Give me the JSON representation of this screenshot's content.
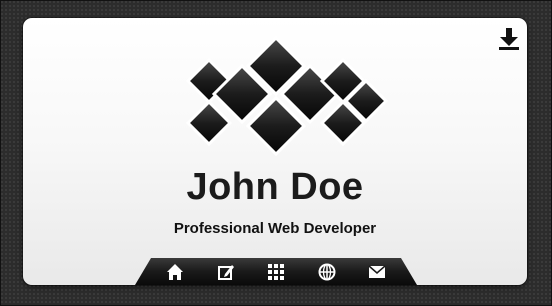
{
  "profile": {
    "name": "John Doe",
    "title": "Professional Web Developer"
  },
  "toolbar": {
    "download_icon": "download-icon"
  },
  "nav": {
    "items": [
      {
        "icon": "home-icon"
      },
      {
        "icon": "edit-icon"
      },
      {
        "icon": "grid-icon"
      },
      {
        "icon": "globe-icon"
      },
      {
        "icon": "mail-icon"
      }
    ]
  },
  "colors": {
    "background": "#2c2c2c",
    "card": "#ffffff",
    "tile": "#111111",
    "nav_bar": "#151515"
  }
}
